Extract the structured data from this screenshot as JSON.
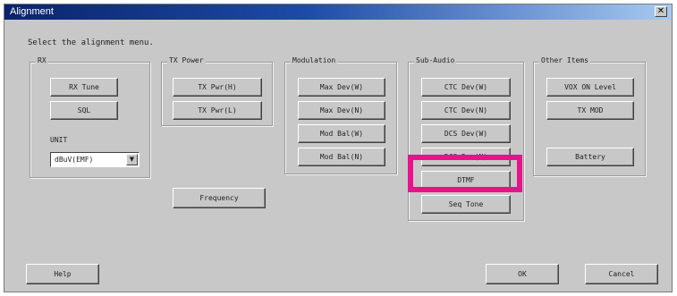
{
  "window": {
    "title": "Alignment",
    "close_glyph": "✕"
  },
  "instruction": "Select the alignment menu.",
  "groups": {
    "rx": {
      "label": "RX",
      "buttons": [
        "RX Tune",
        "SQL"
      ],
      "unit_label": "UNIT",
      "unit_value": "dBuV(EMF)",
      "unit_arrow": "▼"
    },
    "tx_power": {
      "label": "TX Power",
      "buttons": [
        "TX Pwr(H)",
        "TX Pwr(L)"
      ]
    },
    "modulation": {
      "label": "Modulation",
      "buttons": [
        "Max Dev(W)",
        "Max Dev(N)",
        "Mod Bal(W)",
        "Mod Bal(N)"
      ]
    },
    "sub_audio": {
      "label": "Sub-Audio",
      "buttons": [
        "CTC Dev(W)",
        "CTC Dev(N)",
        "DCS Dev(W)",
        "DCS Dev(N)",
        "DTMF",
        "Seq Tone"
      ]
    },
    "other": {
      "label": "Other Items",
      "buttons": [
        "VOX ON Level",
        "TX MOD",
        "Battery"
      ]
    }
  },
  "frequency_button": "Frequency",
  "footer": {
    "help": "Help",
    "ok": "OK",
    "cancel": "Cancel"
  },
  "colors": {
    "titlebar_start": "#0a246a",
    "highlight": "#e8128c",
    "face": "#c8c8c8"
  }
}
